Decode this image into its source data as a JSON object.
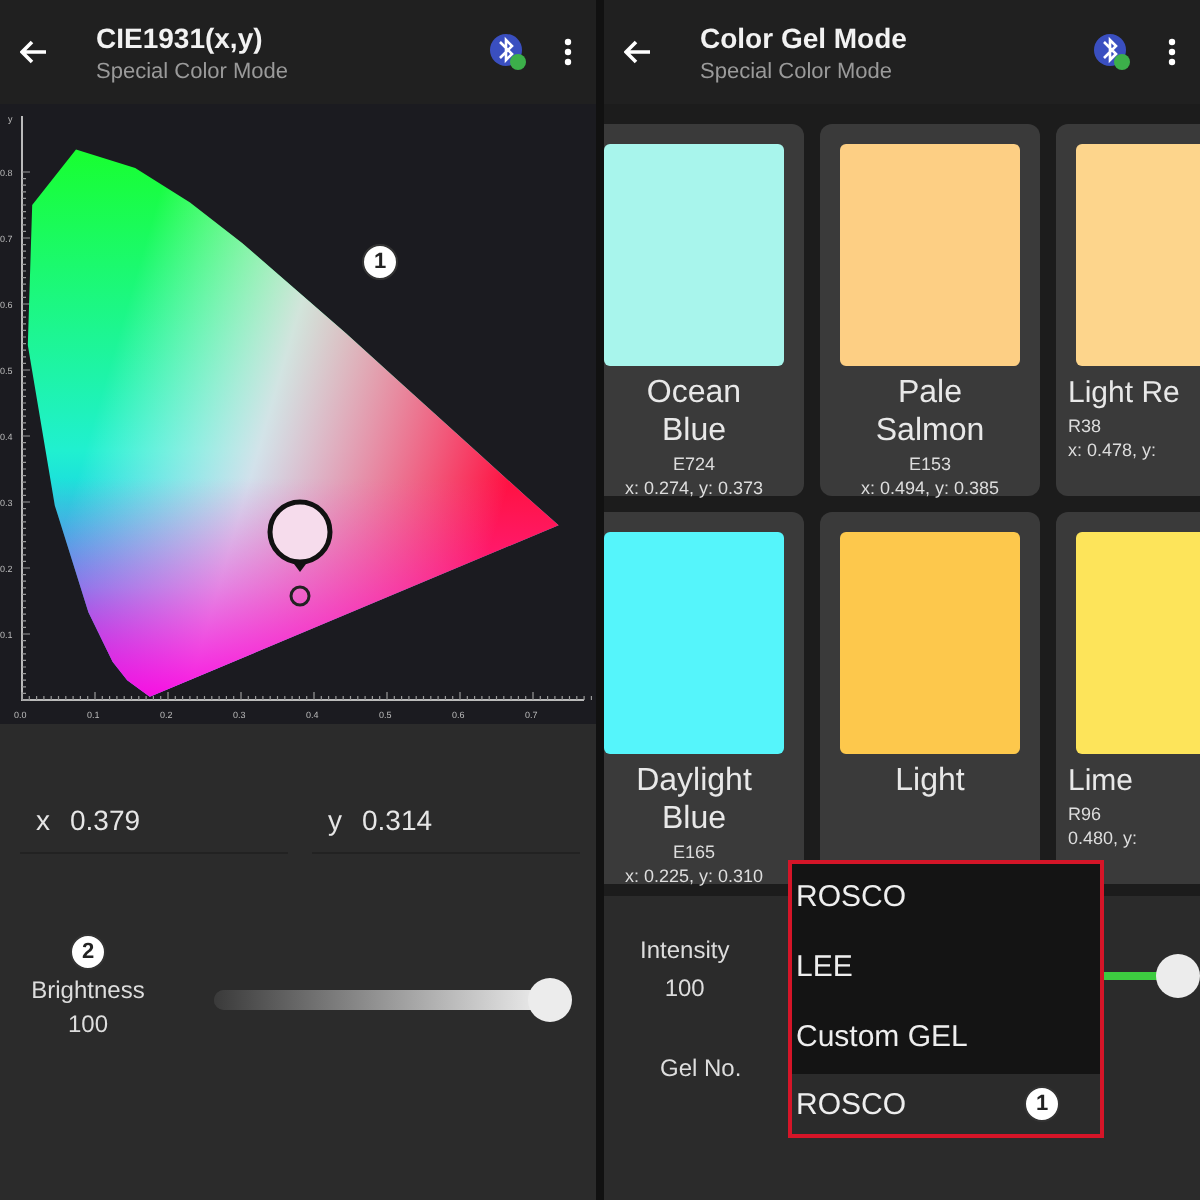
{
  "screens": [
    {
      "kind": "cie",
      "header": {
        "title": "CIE1931(x,y)",
        "subtitle": "Special Color Mode"
      },
      "diagram": {
        "y_axis_label": "y",
        "y_ticks": [
          "0.8",
          "0.7",
          "0.6",
          "0.5",
          "0.4",
          "0.3",
          "0.2",
          "0.1"
        ],
        "x_ticks": [
          "0.0",
          "0.1",
          "0.2",
          "0.3",
          "0.4",
          "0.5",
          "0.6",
          "0.7"
        ],
        "badge": "1"
      },
      "coordinates": [
        {
          "label": "x",
          "value": "0.379"
        },
        {
          "label": "y",
          "value": "0.314"
        }
      ],
      "brightness": {
        "badge": "2",
        "label": "Brightness",
        "value": "100",
        "level": 1.0
      }
    },
    {
      "kind": "gel",
      "header": {
        "title": "Color Gel Mode",
        "subtitle": "Special Color Mode"
      },
      "cards": [
        {
          "name": "Ocean Blue",
          "code": "E724",
          "xy": "x: 0.274, y: 0.373",
          "color": "#a8f5ec"
        },
        {
          "name": "Pale Salmon",
          "code": "E153",
          "xy": "x: 0.494, y: 0.385",
          "color": "#fdcf84"
        },
        {
          "name": "Light Re",
          "code": "R38",
          "xy": "x: 0.478, y:",
          "color": "#fdd58c"
        },
        {
          "name": "Daylight Blue",
          "code": "E165",
          "xy": "x: 0.225, y: 0.310",
          "color": "#55f5fb"
        },
        {
          "name": "Light",
          "color": "#fdc84c"
        },
        {
          "name": "Lime",
          "code": "R96",
          "xy": "0.480, y:",
          "color": "#fde45a"
        }
      ],
      "intensity": {
        "label": "Intensity",
        "value": "100",
        "level": 1.0
      },
      "gel_no": {
        "label": "Gel No.",
        "value": "ROSCO",
        "badge": "1"
      },
      "dropdown": {
        "options": [
          {
            "label": "ROSCO"
          },
          {
            "label": "LEE"
          },
          {
            "label": "Custom GEL"
          }
        ]
      }
    }
  ]
}
